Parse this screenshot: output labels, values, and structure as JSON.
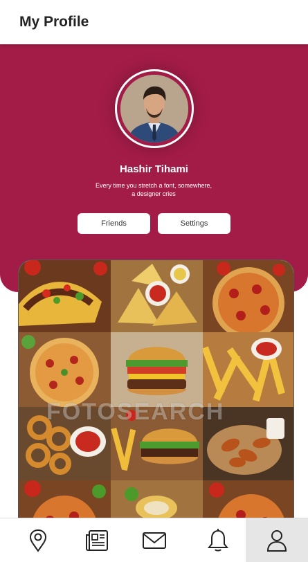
{
  "header": {
    "title": "My Profile"
  },
  "profile": {
    "name": "Hashir Tihami",
    "bio_line1": "Every time you stretch a font, somewhere,",
    "bio_line2": "a designer cries"
  },
  "buttons": {
    "friends": "Friends",
    "settings": "Settings"
  },
  "gallery": {
    "watermark": "FOTOSEARCH",
    "tiles": [
      "tacos",
      "nachos",
      "pizza",
      "pizza",
      "burger",
      "fries",
      "onion-rings",
      "burger-fries",
      "chicken-wings",
      "pizza",
      "food",
      "pizza"
    ]
  },
  "bottom_nav": {
    "items": [
      {
        "icon": "map-pin-icon",
        "active": false
      },
      {
        "icon": "newspaper-icon",
        "active": false
      },
      {
        "icon": "mail-icon",
        "active": false
      },
      {
        "icon": "bell-icon",
        "active": false
      },
      {
        "icon": "user-icon",
        "active": true
      }
    ]
  },
  "colors": {
    "accent": "#a31c47",
    "background": "#ffffff"
  }
}
